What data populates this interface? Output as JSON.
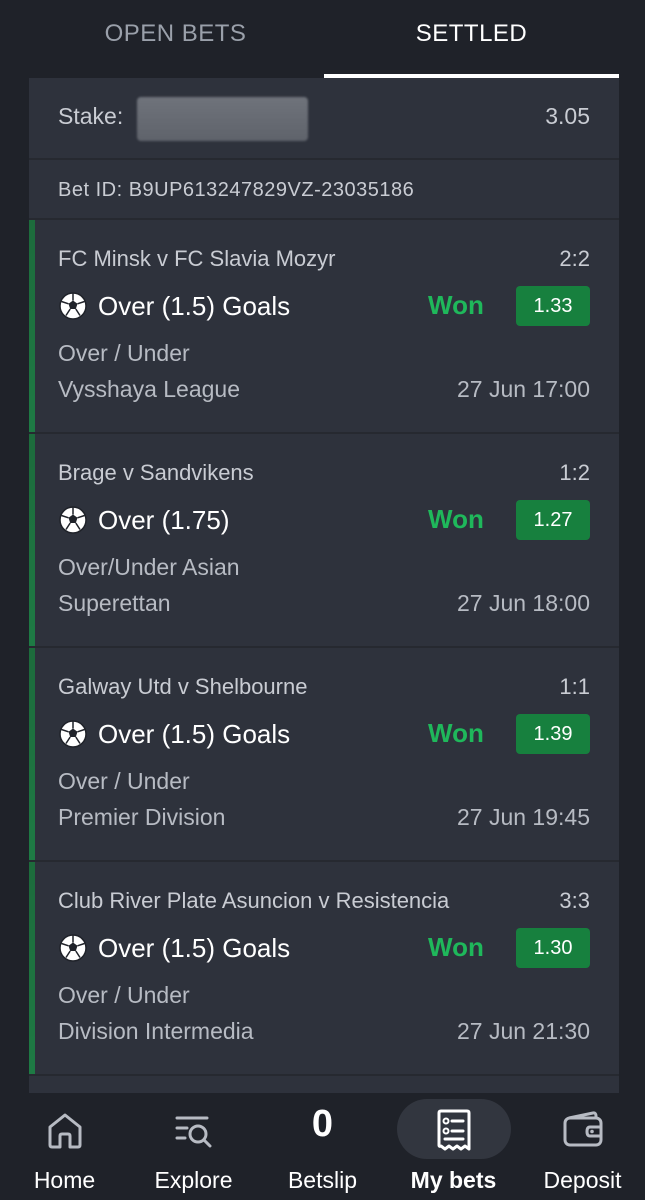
{
  "tabs": {
    "open": "OPEN BETS",
    "settled": "SETTLED"
  },
  "bet": {
    "stake_label": "Stake:",
    "stake_value": "3.05",
    "bet_id": "Bet ID: B9UP613247829VZ-23035186"
  },
  "selections": [
    {
      "match": "FC Minsk v FC Slavia Mozyr",
      "score": "2:2",
      "pick": "Over (1.5) Goals",
      "result": "Won",
      "odds": "1.33",
      "market": "Over / Under",
      "league": "Vysshaya League",
      "datetime": "27 Jun 17:00"
    },
    {
      "match": "Brage v Sandvikens",
      "score": "1:2",
      "pick": "Over (1.75)",
      "result": "Won",
      "odds": "1.27",
      "market": "Over/Under Asian",
      "league": "Superettan",
      "datetime": "27 Jun 18:00"
    },
    {
      "match": "Galway Utd v Shelbourne",
      "score": "1:1",
      "pick": "Over (1.5) Goals",
      "result": "Won",
      "odds": "1.39",
      "market": "Over / Under",
      "league": "Premier Division",
      "datetime": "27 Jun 19:45"
    },
    {
      "match": "Club River Plate Asuncion v Resistencia",
      "score": "3:3",
      "pick": "Over (1.5) Goals",
      "result": "Won",
      "odds": "1.30",
      "market": "Over / Under",
      "league": "Division Intermedia",
      "datetime": "27 Jun 21:30"
    }
  ],
  "nav": {
    "home": "Home",
    "explore": "Explore",
    "betslip": "Betslip",
    "betslip_count": "0",
    "mybets": "My bets",
    "deposit": "Deposit"
  },
  "colors": {
    "won": "#1fb85b",
    "odds_bg": "#17803e",
    "panel": "#2e323c",
    "background": "#1f2229"
  },
  "icons": [
    "soccer-ball-icon",
    "home-icon",
    "explore-icon",
    "my-bets-icon",
    "wallet-icon"
  ]
}
